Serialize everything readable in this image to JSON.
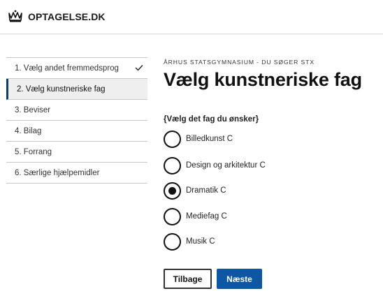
{
  "header": {
    "logo_text": "OPTAGELSE.DK",
    "logo_icon": "crown-icon"
  },
  "steps": [
    {
      "label": "1. Vælg andet fremmedsprog",
      "completed": true
    },
    {
      "label": "2. Vælg kunstneriske fag",
      "active": true
    },
    {
      "label": "3. Beviser"
    },
    {
      "label": "4. Bilag"
    },
    {
      "label": "5. Forrang"
    },
    {
      "label": "6. Særlige hjælpemidler"
    }
  ],
  "main": {
    "eyebrow": "ÅRHUS STATSGYMNASIUM - DU SØGER STX",
    "title": "Vælg kunstneriske fag",
    "question": "{Vælg det fag du ønsker}",
    "options": [
      {
        "label": "Billedkunst C",
        "checked": false
      },
      {
        "label": "Design og arkitektur C",
        "checked": false
      },
      {
        "label": "Dramatik C",
        "checked": true
      },
      {
        "label": "Mediefag C",
        "checked": false
      },
      {
        "label": "Musik C",
        "checked": false
      }
    ]
  },
  "buttons": {
    "back_label": "Tilbage",
    "next_label": "Næste"
  },
  "colors": {
    "primary": "#0d57a3",
    "active_step_border": "#0e3d66"
  }
}
